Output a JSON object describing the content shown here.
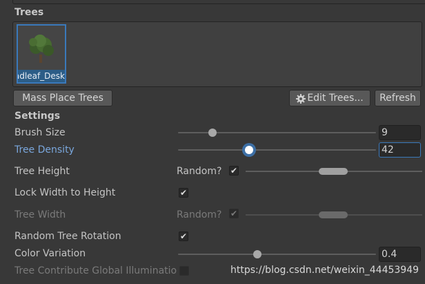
{
  "trees_section": {
    "title": "Trees",
    "items": [
      {
        "name": "Broadleaf_Desk",
        "caption": "adleaf_Desk",
        "selected": true
      }
    ]
  },
  "buttons": {
    "mass_place": "Mass Place Trees",
    "edit_trees": "Edit Trees...",
    "refresh": "Refresh"
  },
  "settings": {
    "title": "Settings",
    "brush_size": {
      "label": "Brush Size",
      "value": "9"
    },
    "tree_density": {
      "label": "Tree Density",
      "value": "42"
    },
    "tree_height": {
      "label": "Tree Height",
      "random_label": "Random?",
      "random_checked": true
    },
    "lock_width": {
      "label": "Lock Width to Height",
      "checked": true
    },
    "tree_width": {
      "label": "Tree Width",
      "random_label": "Random?",
      "random_checked": true,
      "disabled": true
    },
    "random_rotation": {
      "label": "Random Tree Rotation",
      "checked": true
    },
    "color_variation": {
      "label": "Color Variation",
      "value": "0.4"
    },
    "contribute_gi": {
      "label": "Tree Contribute Global Illuminatio",
      "checked": false,
      "disabled": true
    }
  },
  "watermark": "https://blog.csdn.net/weixin_44453949",
  "colors": {
    "accent": "#3a79bb",
    "background": "#383838",
    "field": "#2a2a2a",
    "label_focus": "#7aa7dd"
  }
}
